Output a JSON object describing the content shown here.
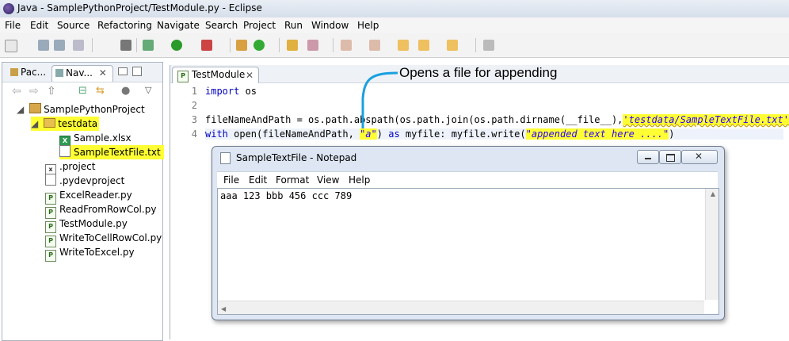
{
  "window": {
    "title": "Java - SamplePythonProject/TestModule.py - Eclipse"
  },
  "menu": [
    "File",
    "Edit",
    "Source",
    "Refactoring",
    "Navigate",
    "Search",
    "Project",
    "Run",
    "Window",
    "Help"
  ],
  "left_panel": {
    "tabs": [
      "Pac...",
      "Nav..."
    ],
    "tree": [
      {
        "label": "SamplePythonProject"
      },
      {
        "label": "testdata"
      },
      {
        "label": "Sample.xlsx"
      },
      {
        "label": "SampleTextFile.txt"
      },
      {
        "label": ".project"
      },
      {
        "label": ".pydevproject"
      },
      {
        "label": "ExcelReader.py"
      },
      {
        "label": "ReadFromRowCol.py"
      },
      {
        "label": "TestModule.py"
      },
      {
        "label": "WriteToCellRowCol.py"
      },
      {
        "label": "WriteToExcel.py"
      }
    ]
  },
  "editor": {
    "tab": "TestModule",
    "line_numbers": [
      "1",
      "2",
      "3",
      "4"
    ],
    "line1": {
      "kw": "import",
      "rest": " os"
    },
    "line3": {
      "pre": "fileNameAndPath = os.path.abspath(os.path.join(os.path.dirname(__file__),",
      "str": "'testdata/SampleTextFile.txt'",
      "post": "))"
    },
    "line4": {
      "kw": "with",
      "a": " open(fileNameAndPath, ",
      "mode": "\"a\"",
      "b": ") ",
      "as": "as",
      "c": " myfile: myfile.write(",
      "str": "\"appended text here ....\"",
      "d": ")"
    }
  },
  "callout": "Opens a file for appending",
  "notepad": {
    "title": "SampleTextFile - Notepad",
    "menu": [
      "File",
      "Edit",
      "Format",
      "View",
      "Help"
    ],
    "content": "aaa 123 bbb 456 ccc 789"
  },
  "colors": {
    "highlight": "#ffff33",
    "callout_line": "#1aa0e0",
    "keyword": "#0000c0",
    "string": "#2a00ff"
  }
}
